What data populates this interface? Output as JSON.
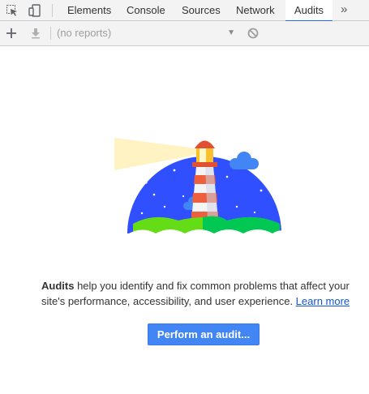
{
  "devtools": {
    "tabs": [
      {
        "label": "Elements"
      },
      {
        "label": "Console"
      },
      {
        "label": "Sources"
      },
      {
        "label": "Network"
      },
      {
        "label": "Audits",
        "active": true
      }
    ],
    "overflow_label": "»"
  },
  "toolbar": {
    "add_label": "+",
    "report_select": {
      "value": "(no reports)"
    }
  },
  "audits": {
    "title_bold": "Audits",
    "description": " help you identify and fix common problems that affect your site's performance, accessibility, and user experience. ",
    "learn_more": "Learn more",
    "perform_button": "Perform an audit..."
  },
  "colors": {
    "accent": "#1a73e8",
    "button": "#4285f4",
    "link": "#1155cc",
    "sky": "#304ffe",
    "grass": "#64dd17"
  },
  "icons": {
    "inspect": "inspect-element-icon",
    "device": "device-toolbar-icon",
    "add": "plus-icon",
    "download": "download-icon",
    "clear": "block-icon"
  }
}
